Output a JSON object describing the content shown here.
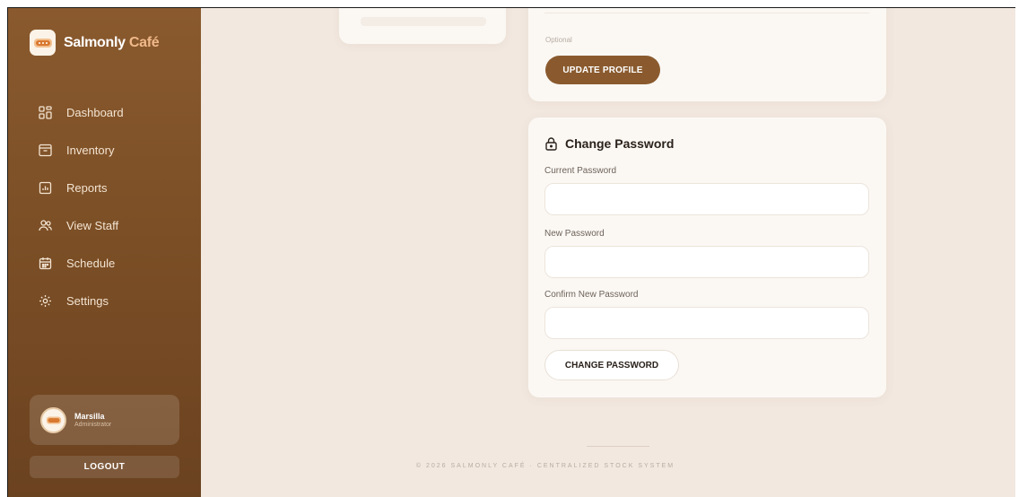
{
  "sidebar": {
    "brand": {
      "name": "Salmonly",
      "accent": "Café"
    },
    "items": [
      {
        "label": "Dashboard",
        "icon": "dashboard-icon"
      },
      {
        "label": "Inventory",
        "icon": "inventory-icon"
      },
      {
        "label": "Reports",
        "icon": "reports-icon"
      },
      {
        "label": "View Staff",
        "icon": "staff-icon"
      },
      {
        "label": "Schedule",
        "icon": "calendar-icon"
      },
      {
        "label": "Settings",
        "icon": "gear-icon"
      }
    ],
    "user": {
      "name": "Marsilla",
      "role": "Administrator"
    },
    "logout_label": "LOGOUT"
  },
  "profile": {
    "hint": "Optional",
    "update_label": "UPDATE PROFILE"
  },
  "password": {
    "title": "Change Password",
    "current_label": "Current Password",
    "current_value": "",
    "new_label": "New Password",
    "new_value": "",
    "confirm_label": "Confirm New Password",
    "confirm_value": "",
    "submit_label": "CHANGE PASSWORD"
  },
  "footer": {
    "text": "© 2026 SALMONLY CAFÉ · CENTRALIZED STOCK SYSTEM"
  },
  "colors": {
    "sidebar": "#7c4f26",
    "primary": "#8a5a2e",
    "background": "#f2e8e0",
    "card": "#fbf8f4"
  }
}
